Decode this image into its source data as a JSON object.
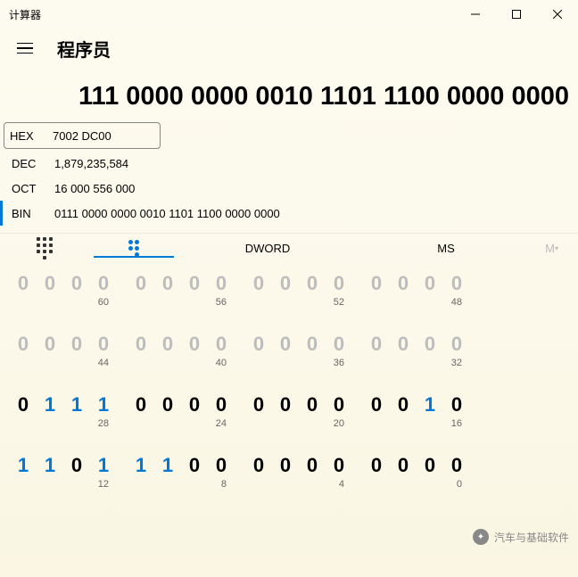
{
  "window": {
    "title": "计算器"
  },
  "mode": {
    "title": "程序员"
  },
  "display": {
    "value": "111 0000 0000 0010 1101 1100 0000 0000"
  },
  "radix": {
    "hex": {
      "label": "HEX",
      "value": "7002 DC00"
    },
    "dec": {
      "label": "DEC",
      "value": "1,879,235,584"
    },
    "oct": {
      "label": "OCT",
      "value": "16 000 556 000"
    },
    "bin": {
      "label": "BIN",
      "value": "0111 0000 0000 0010 1101 1100 0000 0000"
    }
  },
  "tabs": {
    "dword": "DWORD",
    "ms": "MS",
    "m": "M"
  },
  "bitgrid": {
    "rows": [
      {
        "dimmed": true,
        "nibbles": [
          {
            "bits": [
              "0",
              "0",
              "0",
              "0"
            ],
            "label": "60"
          },
          {
            "bits": [
              "0",
              "0",
              "0",
              "0"
            ],
            "label": "56"
          },
          {
            "bits": [
              "0",
              "0",
              "0",
              "0"
            ],
            "label": "52"
          },
          {
            "bits": [
              "0",
              "0",
              "0",
              "0"
            ],
            "label": "48"
          }
        ]
      },
      {
        "dimmed": true,
        "nibbles": [
          {
            "bits": [
              "0",
              "0",
              "0",
              "0"
            ],
            "label": "44"
          },
          {
            "bits": [
              "0",
              "0",
              "0",
              "0"
            ],
            "label": "40"
          },
          {
            "bits": [
              "0",
              "0",
              "0",
              "0"
            ],
            "label": "36"
          },
          {
            "bits": [
              "0",
              "0",
              "0",
              "0"
            ],
            "label": "32"
          }
        ]
      },
      {
        "dimmed": false,
        "nibbles": [
          {
            "bits": [
              "0",
              "1",
              "1",
              "1"
            ],
            "label": "28"
          },
          {
            "bits": [
              "0",
              "0",
              "0",
              "0"
            ],
            "label": "24"
          },
          {
            "bits": [
              "0",
              "0",
              "0",
              "0"
            ],
            "label": "20"
          },
          {
            "bits": [
              "0",
              "0",
              "1",
              "0"
            ],
            "label": "16"
          }
        ]
      },
      {
        "dimmed": false,
        "nibbles": [
          {
            "bits": [
              "1",
              "1",
              "0",
              "1"
            ],
            "label": "12"
          },
          {
            "bits": [
              "1",
              "1",
              "0",
              "0"
            ],
            "label": "8"
          },
          {
            "bits": [
              "0",
              "0",
              "0",
              "0"
            ],
            "label": "4"
          },
          {
            "bits": [
              "0",
              "0",
              "0",
              "0"
            ],
            "label": "0"
          }
        ]
      }
    ]
  },
  "watermark": {
    "text": "汽车与基础软件"
  }
}
